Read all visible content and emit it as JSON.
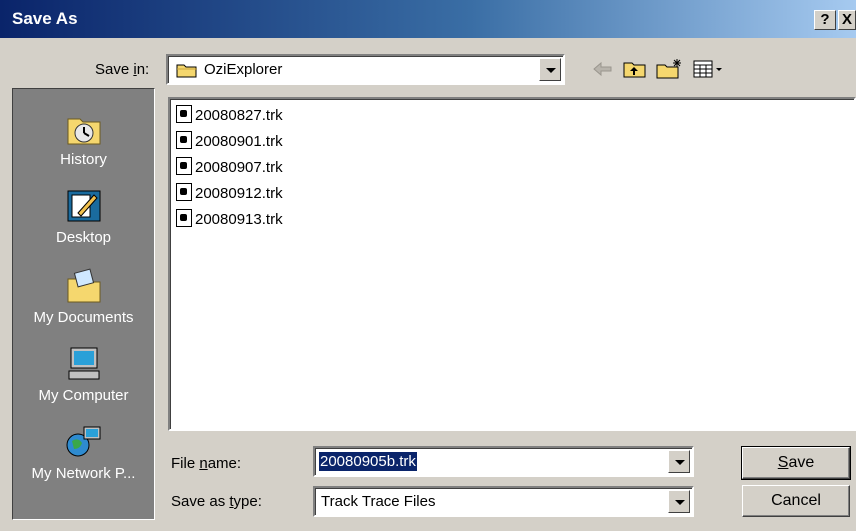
{
  "window": {
    "title": "Save As",
    "help_label": "?",
    "close_label": "X"
  },
  "save_in": {
    "label_prefix": "Save ",
    "label_accel": "i",
    "label_suffix": "n:",
    "value": "OziExplorer"
  },
  "places": [
    {
      "label": "History",
      "icon": "history-icon"
    },
    {
      "label": "Desktop",
      "icon": "desktop-icon"
    },
    {
      "label": "My Documents",
      "icon": "my-documents-icon"
    },
    {
      "label": "My Computer",
      "icon": "my-computer-icon"
    },
    {
      "label": "My Network P...",
      "icon": "network-places-icon"
    }
  ],
  "files": [
    {
      "name": "20080827.trk"
    },
    {
      "name": "20080901.trk"
    },
    {
      "name": "20080907.trk"
    },
    {
      "name": "20080912.trk"
    },
    {
      "name": "20080913.trk"
    }
  ],
  "file_name": {
    "label_prefix": "File ",
    "label_accel": "n",
    "label_suffix": "ame:",
    "value": "20080905b.trk"
  },
  "save_as_type": {
    "label_prefix": "Save as ",
    "label_accel": "t",
    "label_suffix": "ype:",
    "value": "Track Trace Files"
  },
  "buttons": {
    "save_accel": "S",
    "save_rest": "ave",
    "cancel": "Cancel"
  },
  "colors": {
    "title_bar": "#0a246a",
    "selection": "#0a246a",
    "face": "#d4d0c8",
    "places_bar": "#808080"
  }
}
